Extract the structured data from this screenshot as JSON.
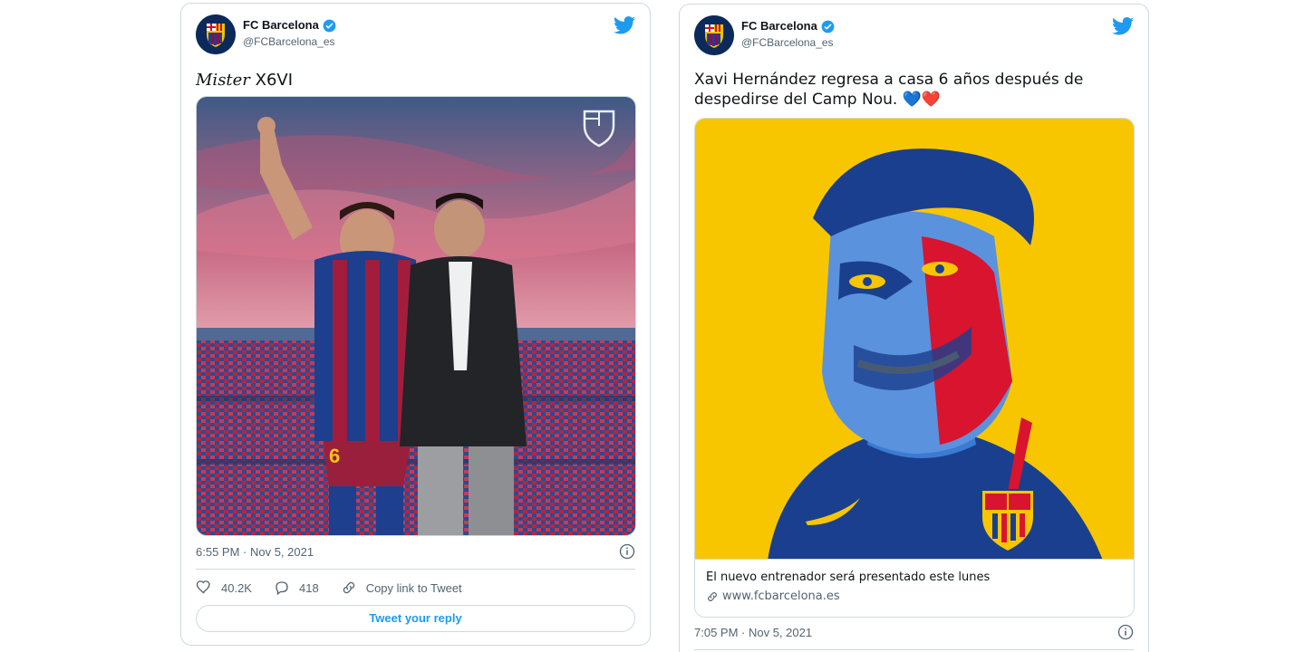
{
  "colors": {
    "accent": "#1d9bf0",
    "text_secondary": "#536471",
    "border": "#cfd9de"
  },
  "tweet1": {
    "display_name": "FC Barcelona",
    "handle": "@FCBarcelona_es",
    "text_italic": "Mister",
    "text_rest": " X6VI",
    "timestamp": "6:55 PM · Nov 5, 2021",
    "likes": "40.2K",
    "replies": "418",
    "copy_link": "Copy link to Tweet",
    "reply_button": "Tweet your reply",
    "icons": [
      "verified-icon",
      "twitter-bird-icon",
      "info-icon",
      "heart-icon",
      "reply-icon",
      "link-icon"
    ]
  },
  "tweet2": {
    "display_name": "FC Barcelona",
    "handle": "@FCBarcelona_es",
    "text_line1": "Xavi Hernández regresa a casa 6 años después de",
    "text_line2": "despedirse del Camp Nou.",
    "emoji": "💙❤️",
    "link_card_title": "El nuevo entrenador será presentado este lunes",
    "link_card_domain": "www.fcbarcelona.es",
    "timestamp": "7:05 PM · Nov 5, 2021"
  }
}
